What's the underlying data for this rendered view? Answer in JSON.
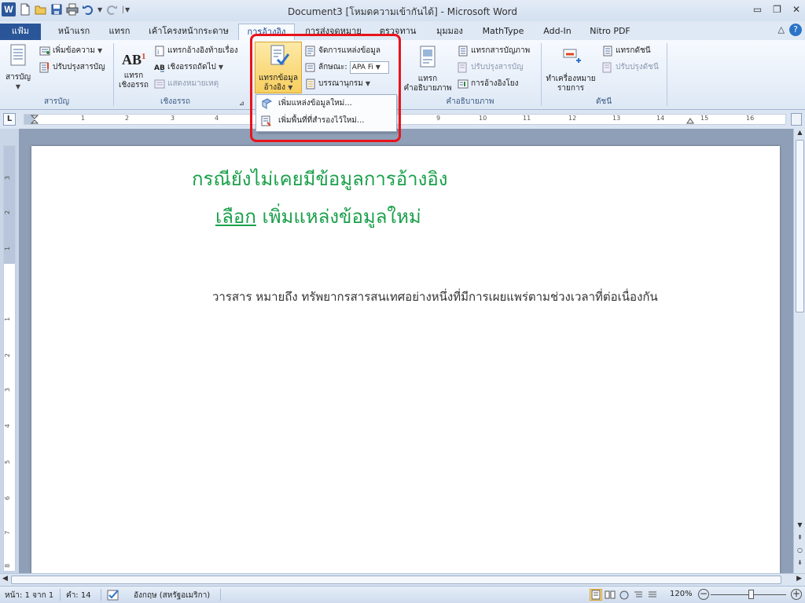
{
  "window": {
    "title": "Document3 [โหมดความเข้ากันได้] - Microsoft Word",
    "app_icon": "W"
  },
  "tabs": [
    "แฟ้ม",
    "หน้าแรก",
    "แทรก",
    "เค้าโครงหน้ากระดาษ",
    "การอ้างอิง",
    "การส่งจดหมาย",
    "ตรวจทาน",
    "มุมมอง",
    "MathType",
    "Add-In",
    "Nitro PDF"
  ],
  "active_tab": "การอ้างอิง",
  "ribbon": {
    "toc": {
      "big_label": "สารบัญ",
      "add_text": "เพิ่มข้อความ",
      "update_table": "ปรับปรุงสารบัญ",
      "group": "สารบัญ"
    },
    "footnotes": {
      "big_icon_text": "AB",
      "big_icon_sup": "1",
      "big_label_1": "แทรก",
      "big_label_2": "เชิงอรรถ",
      "insert_endnote": "แทรกอ้างอิงท้ายเรื่อง",
      "next_footnote": "เชิงอรรถถัดไป",
      "show_notes": "แสดงหมายเหตุ",
      "group": "เชิงอรรถ"
    },
    "citations": {
      "insert_citation_1": "แทรกข้อมูล",
      "insert_citation_2": "อ้างอิง",
      "manage_sources": "จัดการแหล่งข้อมูล",
      "style_label": "ลักษณะ:",
      "style_value": "APA Fi",
      "bibliography": "บรรณานุกรม"
    },
    "captions": {
      "big_label_1": "แทรก",
      "big_label_2": "คำอธิบายภาพ",
      "insert_table_of_figures": "แทรกสารบัญภาพ",
      "update_table": "ปรับปรุงสารบัญ",
      "cross_reference": "การอ้างอิงโยง",
      "group": "คำอธิบายภาพ"
    },
    "index": {
      "mark_entry_1": "ทำเครื่องหมาย",
      "mark_entry_2": "รายการ",
      "insert_index": "แทรกดัชนี",
      "update_index": "ปรับปรุงดัชนี",
      "group": "ดัชนี"
    }
  },
  "dropdown": {
    "items": [
      "เพิ่มแหล่งข้อมูลใหม่...",
      "เพิ่มพื้นที่ที่สำรองไว้ใหม่..."
    ]
  },
  "ruler": {
    "tab_selector": "L",
    "numbers": [
      "1",
      "2",
      "3",
      "4",
      "9",
      "10",
      "11",
      "12",
      "13",
      "14",
      "15",
      "16"
    ],
    "v_numbers": [
      "3",
      "2",
      "1",
      "1",
      "2",
      "3",
      "4",
      "5",
      "6",
      "7",
      "8"
    ]
  },
  "document": {
    "annotation_line1": "กรณียังไม่เคยมีข้อมูลการอ้างอิง",
    "annotation_choose": "เลือก",
    "annotation_rest": " เพิ่มแหล่งข้อมูลใหม่",
    "body_text": "วารสาร หมายถึง ทรัพยากรสารสนเทศอย่างหนึ่งที่มีการเผยแพร่ตามช่วงเวลาที่ต่อเนื่องกัน"
  },
  "status": {
    "page": "หน้า: 1 จาก 1",
    "words": "คำ: 14",
    "language": "อังกฤษ (สหรัฐอเมริกา)",
    "zoom": "120%"
  },
  "colors": {
    "annotation": "#1aa04a",
    "highlight": "#e8141a",
    "file_tab": "#2a5699"
  }
}
